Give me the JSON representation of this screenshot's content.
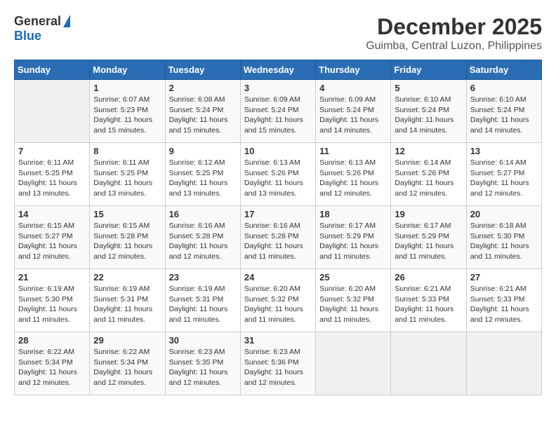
{
  "logo": {
    "general": "General",
    "blue": "Blue"
  },
  "title": "December 2025",
  "location": "Guimba, Central Luzon, Philippines",
  "weekdays": [
    "Sunday",
    "Monday",
    "Tuesday",
    "Wednesday",
    "Thursday",
    "Friday",
    "Saturday"
  ],
  "weeks": [
    [
      {
        "day": "",
        "info": ""
      },
      {
        "day": "1",
        "info": "Sunrise: 6:07 AM\nSunset: 5:23 PM\nDaylight: 11 hours\nand 15 minutes."
      },
      {
        "day": "2",
        "info": "Sunrise: 6:08 AM\nSunset: 5:24 PM\nDaylight: 11 hours\nand 15 minutes."
      },
      {
        "day": "3",
        "info": "Sunrise: 6:09 AM\nSunset: 5:24 PM\nDaylight: 11 hours\nand 15 minutes."
      },
      {
        "day": "4",
        "info": "Sunrise: 6:09 AM\nSunset: 5:24 PM\nDaylight: 11 hours\nand 14 minutes."
      },
      {
        "day": "5",
        "info": "Sunrise: 6:10 AM\nSunset: 5:24 PM\nDaylight: 11 hours\nand 14 minutes."
      },
      {
        "day": "6",
        "info": "Sunrise: 6:10 AM\nSunset: 5:24 PM\nDaylight: 11 hours\nand 14 minutes."
      }
    ],
    [
      {
        "day": "7",
        "info": "Sunrise: 6:11 AM\nSunset: 5:25 PM\nDaylight: 11 hours\nand 13 minutes."
      },
      {
        "day": "8",
        "info": "Sunrise: 6:11 AM\nSunset: 5:25 PM\nDaylight: 11 hours\nand 13 minutes."
      },
      {
        "day": "9",
        "info": "Sunrise: 6:12 AM\nSunset: 5:25 PM\nDaylight: 11 hours\nand 13 minutes."
      },
      {
        "day": "10",
        "info": "Sunrise: 6:13 AM\nSunset: 5:26 PM\nDaylight: 11 hours\nand 13 minutes."
      },
      {
        "day": "11",
        "info": "Sunrise: 6:13 AM\nSunset: 5:26 PM\nDaylight: 11 hours\nand 12 minutes."
      },
      {
        "day": "12",
        "info": "Sunrise: 6:14 AM\nSunset: 5:26 PM\nDaylight: 11 hours\nand 12 minutes."
      },
      {
        "day": "13",
        "info": "Sunrise: 6:14 AM\nSunset: 5:27 PM\nDaylight: 11 hours\nand 12 minutes."
      }
    ],
    [
      {
        "day": "14",
        "info": "Sunrise: 6:15 AM\nSunset: 5:27 PM\nDaylight: 11 hours\nand 12 minutes."
      },
      {
        "day": "15",
        "info": "Sunrise: 6:15 AM\nSunset: 5:28 PM\nDaylight: 11 hours\nand 12 minutes."
      },
      {
        "day": "16",
        "info": "Sunrise: 6:16 AM\nSunset: 5:28 PM\nDaylight: 11 hours\nand 12 minutes."
      },
      {
        "day": "17",
        "info": "Sunrise: 6:16 AM\nSunset: 5:28 PM\nDaylight: 11 hours\nand 11 minutes."
      },
      {
        "day": "18",
        "info": "Sunrise: 6:17 AM\nSunset: 5:29 PM\nDaylight: 11 hours\nand 11 minutes."
      },
      {
        "day": "19",
        "info": "Sunrise: 6:17 AM\nSunset: 5:29 PM\nDaylight: 11 hours\nand 11 minutes."
      },
      {
        "day": "20",
        "info": "Sunrise: 6:18 AM\nSunset: 5:30 PM\nDaylight: 11 hours\nand 11 minutes."
      }
    ],
    [
      {
        "day": "21",
        "info": "Sunrise: 6:19 AM\nSunset: 5:30 PM\nDaylight: 11 hours\nand 11 minutes."
      },
      {
        "day": "22",
        "info": "Sunrise: 6:19 AM\nSunset: 5:31 PM\nDaylight: 11 hours\nand 11 minutes."
      },
      {
        "day": "23",
        "info": "Sunrise: 6:19 AM\nSunset: 5:31 PM\nDaylight: 11 hours\nand 11 minutes."
      },
      {
        "day": "24",
        "info": "Sunrise: 6:20 AM\nSunset: 5:32 PM\nDaylight: 11 hours\nand 11 minutes."
      },
      {
        "day": "25",
        "info": "Sunrise: 6:20 AM\nSunset: 5:32 PM\nDaylight: 11 hours\nand 11 minutes."
      },
      {
        "day": "26",
        "info": "Sunrise: 6:21 AM\nSunset: 5:33 PM\nDaylight: 11 hours\nand 11 minutes."
      },
      {
        "day": "27",
        "info": "Sunrise: 6:21 AM\nSunset: 5:33 PM\nDaylight: 11 hours\nand 12 minutes."
      }
    ],
    [
      {
        "day": "28",
        "info": "Sunrise: 6:22 AM\nSunset: 5:34 PM\nDaylight: 11 hours\nand 12 minutes."
      },
      {
        "day": "29",
        "info": "Sunrise: 6:22 AM\nSunset: 5:34 PM\nDaylight: 11 hours\nand 12 minutes."
      },
      {
        "day": "30",
        "info": "Sunrise: 6:23 AM\nSunset: 5:35 PM\nDaylight: 11 hours\nand 12 minutes."
      },
      {
        "day": "31",
        "info": "Sunrise: 6:23 AM\nSunset: 5:36 PM\nDaylight: 11 hours\nand 12 minutes."
      },
      {
        "day": "",
        "info": ""
      },
      {
        "day": "",
        "info": ""
      },
      {
        "day": "",
        "info": ""
      }
    ]
  ]
}
